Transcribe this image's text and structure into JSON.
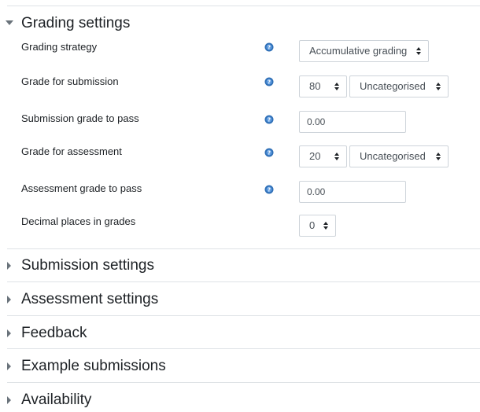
{
  "sections": {
    "grading": {
      "title": "Grading settings",
      "expanded": true
    },
    "submission": {
      "title": "Submission settings",
      "expanded": false
    },
    "assessment": {
      "title": "Assessment settings",
      "expanded": false
    },
    "feedback": {
      "title": "Feedback",
      "expanded": false
    },
    "examples": {
      "title": "Example submissions",
      "expanded": false
    },
    "availability": {
      "title": "Availability",
      "expanded": false
    }
  },
  "fields": {
    "grading_strategy": {
      "label": "Grading strategy",
      "value": "Accumulative grading"
    },
    "grade_submission": {
      "label": "Grade for submission",
      "value": "80",
      "category": "Uncategorised"
    },
    "submission_pass": {
      "label": "Submission grade to pass",
      "value": "0.00"
    },
    "grade_assessment": {
      "label": "Grade for assessment",
      "value": "20",
      "category": "Uncategorised"
    },
    "assessment_pass": {
      "label": "Assessment grade to pass",
      "value": "0.00"
    },
    "decimal_places": {
      "label": "Decimal places in grades",
      "value": "0"
    }
  },
  "colors": {
    "help_icon": "#2f6fb6",
    "border": "#ced4da",
    "divider": "#dee2e6",
    "text": "#1d2125"
  },
  "icons": {
    "expanded": "caret-down-icon",
    "collapsed": "caret-right-icon",
    "help": "question-circle-icon"
  }
}
